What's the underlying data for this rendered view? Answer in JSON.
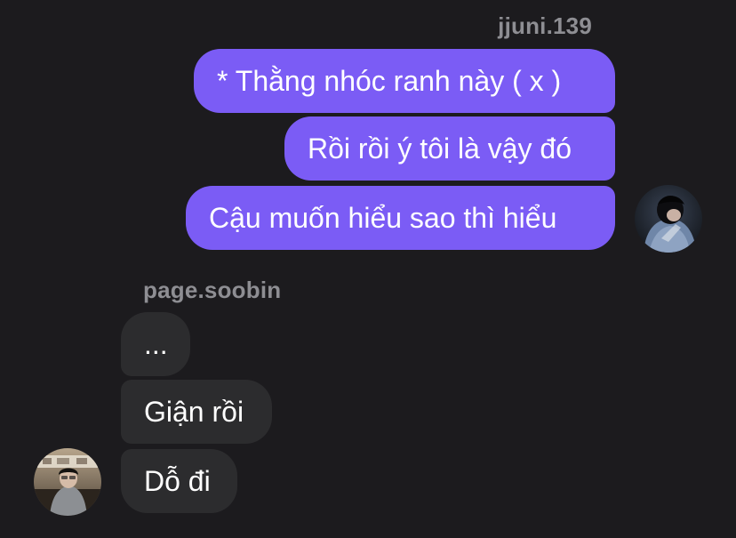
{
  "conversation": {
    "sent": {
      "username": "jjuni.139",
      "messages": [
        "* Thằng nhóc ranh này ( x )",
        "Rồi rồi ý tôi là vậy đó",
        "Cậu muốn hiểu sao thì hiểu"
      ],
      "avatar_icon": "profile-photo-person-hoodie"
    },
    "received": {
      "username": "page.soobin",
      "messages": [
        "...",
        "Giận rồi",
        "Dỗ đi"
      ],
      "avatar_icon": "profile-photo-person-cafe"
    }
  },
  "colors": {
    "background": "#1c1b1e",
    "sent_bubble": "#7b5cf5",
    "received_bubble": "#2c2c2e",
    "username_text": "#8e8e93",
    "message_text": "#ffffff"
  }
}
